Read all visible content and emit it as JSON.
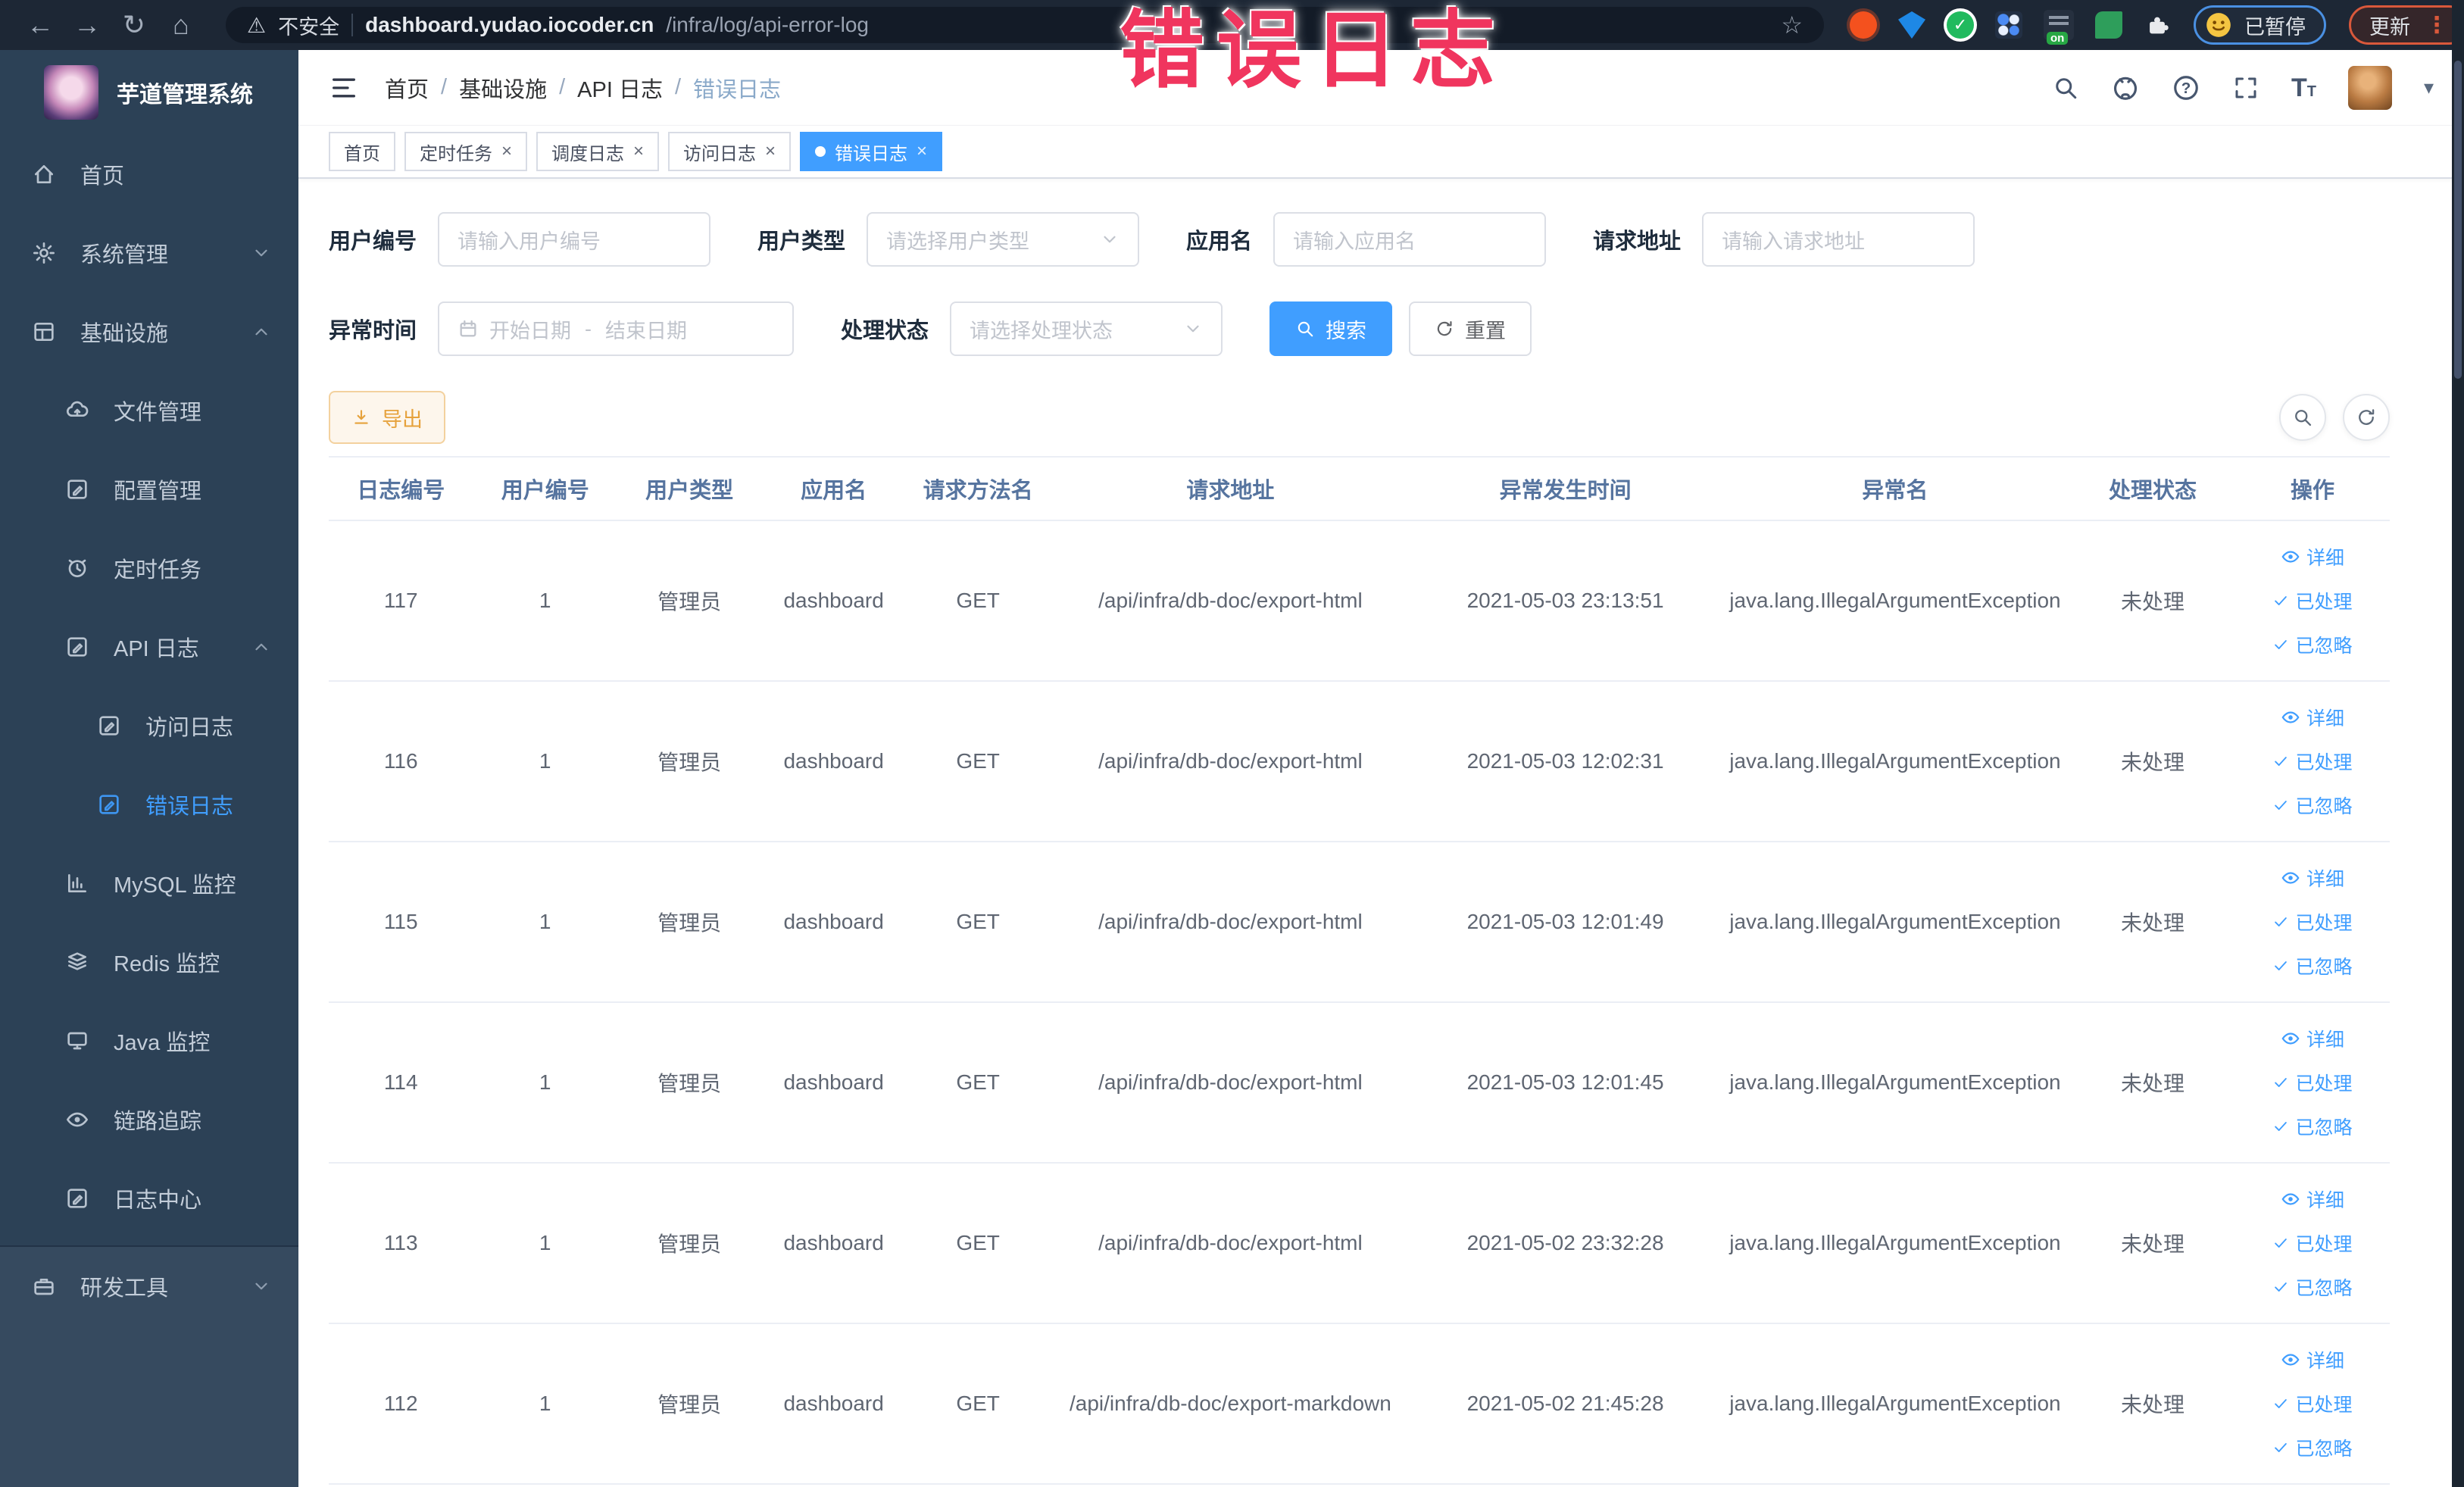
{
  "browser": {
    "security_label": "不安全",
    "url_host": "dashboard.yudao.iocoder.cn",
    "url_path": "/infra/log/api-error-log",
    "paused_chip": "已暂停",
    "update_button": "更新"
  },
  "icons": {
    "back": "←",
    "forward": "→",
    "reload": "↻",
    "home": "⌂",
    "warning": "⚠",
    "star": "☆",
    "kebab": "⋮",
    "caret_down": "▾",
    "close": "×"
  },
  "watermark": {
    "text": "错误日志",
    "color": "#f0355e"
  },
  "sidebar": {
    "logo_title": "芋道管理系统",
    "items": [
      {
        "key": "home",
        "label": "首页",
        "icon": "home-icon",
        "depth": 0
      },
      {
        "key": "system-manage",
        "label": "系统管理",
        "icon": "gear-icon",
        "depth": 0,
        "chevron": "down"
      },
      {
        "key": "infrastructure",
        "label": "基础设施",
        "icon": "infrastructure-icon",
        "depth": 0,
        "chevron": "up"
      },
      {
        "key": "file-manage",
        "label": "文件管理",
        "icon": "file-manage-icon",
        "depth": 1
      },
      {
        "key": "config-manage",
        "label": "配置管理",
        "icon": "edit-square-icon",
        "depth": 1
      },
      {
        "key": "scheduled-job",
        "label": "定时任务",
        "icon": "schedule-icon",
        "depth": 1
      },
      {
        "key": "api-log",
        "label": "API 日志",
        "icon": "edit-square-icon",
        "depth": 1,
        "chevron": "up"
      },
      {
        "key": "access-log",
        "label": "访问日志",
        "icon": "edit-square-icon",
        "depth": 2
      },
      {
        "key": "error-log",
        "label": "错误日志",
        "icon": "edit-square-icon",
        "depth": 2,
        "active": true
      },
      {
        "key": "mysql-monitor",
        "label": "MySQL 监控",
        "icon": "chart-icon",
        "depth": 1
      },
      {
        "key": "redis-monitor",
        "label": "Redis 监控",
        "icon": "layers-icon",
        "depth": 1
      },
      {
        "key": "java-monitor",
        "label": "Java 监控",
        "icon": "monitor-icon",
        "depth": 1
      },
      {
        "key": "trace",
        "label": "链路追踪",
        "icon": "eye-icon",
        "depth": 1
      },
      {
        "key": "log-center",
        "label": "日志中心",
        "icon": "edit-square-icon",
        "depth": 1
      },
      {
        "key": "dev-tool",
        "label": "研发工具",
        "icon": "devtool-icon",
        "depth": 0,
        "chevron": "down",
        "section": "bottom"
      }
    ]
  },
  "header": {
    "breadcrumb": [
      "首页",
      "基础设施",
      "API 日志",
      "错误日志"
    ]
  },
  "tabs": [
    {
      "key": "home",
      "label": "首页",
      "closable": false,
      "active": false
    },
    {
      "key": "scheduled-job",
      "label": "定时任务",
      "closable": true,
      "active": false
    },
    {
      "key": "dispatch-log",
      "label": "调度日志",
      "closable": true,
      "active": false
    },
    {
      "key": "access-log",
      "label": "访问日志",
      "closable": true,
      "active": false
    },
    {
      "key": "error-log",
      "label": "错误日志",
      "closable": true,
      "active": true
    }
  ],
  "filters": {
    "user_id": {
      "label": "用户编号",
      "placeholder": "请输入用户编号"
    },
    "user_type": {
      "label": "用户类型",
      "placeholder": "请选择用户类型"
    },
    "app_name": {
      "label": "应用名",
      "placeholder": "请输入应用名"
    },
    "request_url": {
      "label": "请求地址",
      "placeholder": "请输入请求地址"
    },
    "exception_time": {
      "label": "异常时间",
      "start_placeholder": "开始日期",
      "separator": "-",
      "end_placeholder": "结束日期"
    },
    "process_status": {
      "label": "处理状态",
      "placeholder": "请选择处理状态"
    },
    "search_button": "搜索",
    "reset_button": "重置"
  },
  "toolbar": {
    "export_button": "导出"
  },
  "table": {
    "columns": [
      "日志编号",
      "用户编号",
      "用户类型",
      "应用名",
      "请求方法名",
      "请求地址",
      "异常发生时间",
      "异常名",
      "处理状态",
      "操作"
    ],
    "action_labels": {
      "detail": "详细",
      "processed": "已处理",
      "ignored": "已忽略"
    },
    "rows": [
      [
        "117",
        "1",
        "管理员",
        "dashboard",
        "GET",
        "/api/infra/db-doc/export-html",
        "2021-05-03 23:13:51",
        "java.lang.IllegalArgumentException",
        "未处理"
      ],
      [
        "116",
        "1",
        "管理员",
        "dashboard",
        "GET",
        "/api/infra/db-doc/export-html",
        "2021-05-03 12:02:31",
        "java.lang.IllegalArgumentException",
        "未处理"
      ],
      [
        "115",
        "1",
        "管理员",
        "dashboard",
        "GET",
        "/api/infra/db-doc/export-html",
        "2021-05-03 12:01:49",
        "java.lang.IllegalArgumentException",
        "未处理"
      ],
      [
        "114",
        "1",
        "管理员",
        "dashboard",
        "GET",
        "/api/infra/db-doc/export-html",
        "2021-05-03 12:01:45",
        "java.lang.IllegalArgumentException",
        "未处理"
      ],
      [
        "113",
        "1",
        "管理员",
        "dashboard",
        "GET",
        "/api/infra/db-doc/export-html",
        "2021-05-02 23:32:28",
        "java.lang.IllegalArgumentException",
        "未处理"
      ],
      [
        "112",
        "1",
        "管理员",
        "dashboard",
        "GET",
        "/api/infra/db-doc/export-markdown",
        "2021-05-02 21:45:28",
        "java.lang.IllegalArgumentException",
        "未处理"
      ]
    ]
  },
  "colors": {
    "accent": "#409eff",
    "warning": "#e6a23c",
    "watermark": "#f0355e",
    "sidebar_bg": "#2c4156",
    "browser_bar_bg": "#1d2735"
  }
}
